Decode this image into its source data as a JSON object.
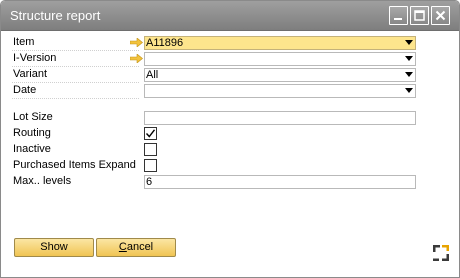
{
  "window": {
    "title": "Structure report",
    "controls": {
      "minimize_icon": "minimize-icon",
      "maximize_icon": "maximize-icon",
      "close_icon": "close-icon"
    }
  },
  "form": {
    "item": {
      "label": "Item",
      "value": "A11896",
      "icon": "link-arrow-icon",
      "highlight_color": "#fde58d"
    },
    "i_version": {
      "label": "I-Version",
      "value": "",
      "icon": "link-arrow-icon"
    },
    "variant": {
      "label": "Variant",
      "value": "All"
    },
    "date": {
      "label": "Date",
      "value": ""
    },
    "lot_size": {
      "label": "Lot Size",
      "value": ""
    },
    "routing": {
      "label": "Routing",
      "checked": true
    },
    "inactive": {
      "label": "Inactive",
      "checked": false
    },
    "purchased_items_expand": {
      "label": "Purchased Items Expand",
      "checked": false
    },
    "max_levels": {
      "label": "Max.. levels",
      "value": "6"
    }
  },
  "buttons": {
    "show": "Show",
    "cancel": "Cancel"
  },
  "accent_colors": {
    "button_gradient_top": "#fbe6a4",
    "button_gradient_bottom": "#f0c453",
    "arrow": "#f2c23c"
  }
}
